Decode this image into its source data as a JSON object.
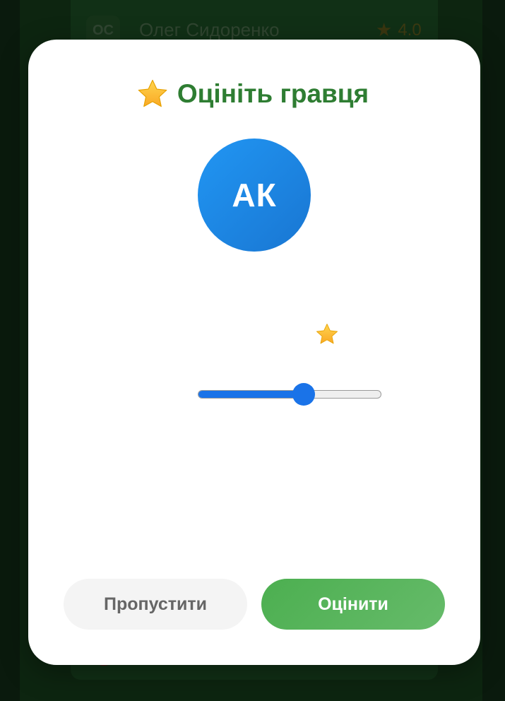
{
  "background": {
    "player": {
      "initials": "ОС",
      "name": "Олег Сидоренко",
      "rating": "4.0",
      "rating_icon": "star-icon"
    }
  },
  "modal": {
    "title_icon": "star-icon",
    "title": "Оцініть гравця",
    "player_initials": "АК",
    "rating_icon": "star-icon",
    "rating_slider": {
      "min": 1,
      "max": 5,
      "value": 3.35
    },
    "skip_label": "Пропустити",
    "rate_label": "Оцінити"
  },
  "colors": {
    "title": "#2e7d32",
    "avatar_start": "#2196f3",
    "avatar_end": "#1976d2",
    "slider_accent": "#1a73e8",
    "rate_button_start": "#4caf50",
    "rate_button_end": "#66bb6a",
    "skip_button_bg": "#f4f4f4",
    "skip_button_text": "#666666"
  }
}
